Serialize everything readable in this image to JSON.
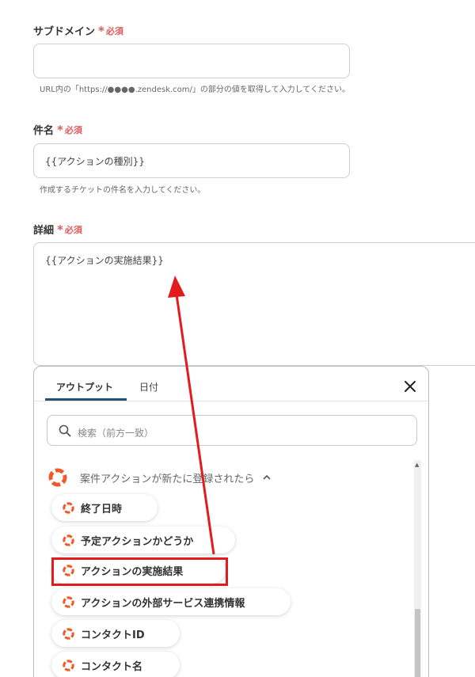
{
  "form": {
    "subdomain": {
      "label": "サブドメイン",
      "required": "必須",
      "value": "",
      "help": "URL内の「https://●●●●.zendesk.com/」の部分の値を取得して入力してください。"
    },
    "subject": {
      "label": "件名",
      "required": "必須",
      "value": "{{アクションの種別}}",
      "help": "作成するチケットの件名を入力してください。"
    },
    "detail": {
      "label": "詳細",
      "required": "必須",
      "value": "{{アクションの実施結果}}"
    }
  },
  "popup": {
    "tabs": [
      {
        "label": "アウトプット",
        "active": true
      },
      {
        "label": "日付",
        "active": false
      }
    ],
    "search_placeholder": "検索（前方一致）",
    "group": {
      "title": "案件アクションが新たに登録されたら",
      "items": [
        {
          "label": "終了日時"
        },
        {
          "label": "予定アクションかどうか"
        },
        {
          "label": "アクションの実施結果",
          "highlighted": true
        },
        {
          "label": "アクションの外部サービス連携情報"
        },
        {
          "label": "コンタクトID"
        },
        {
          "label": "コンタクト名"
        }
      ]
    },
    "icons": {
      "close": "close-icon",
      "search": "search-icon",
      "group": "lifebuoy-icon",
      "chevron": "chevron-up-icon"
    }
  },
  "colors": {
    "required": "#e05a5a",
    "tab_underline": "#24527a",
    "icon_orange": "#f05a28",
    "annotation_red": "#e21c1c"
  }
}
